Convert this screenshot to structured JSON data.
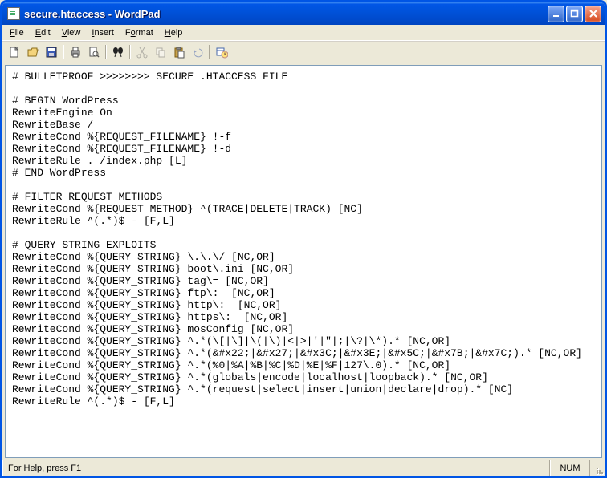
{
  "window": {
    "title": "secure.htaccess - WordPad"
  },
  "menu": {
    "file": "File",
    "edit": "Edit",
    "view": "View",
    "insert": "Insert",
    "format": "Format",
    "help": "Help"
  },
  "toolbar_icons": {
    "new": "new-file-icon",
    "open": "open-icon",
    "save": "save-icon",
    "print": "print-icon",
    "preview": "print-preview-icon",
    "find": "find-icon",
    "cut": "cut-icon",
    "copy": "copy-icon",
    "paste": "paste-icon",
    "undo": "undo-icon",
    "datetime": "datetime-icon"
  },
  "document_lines": [
    "# BULLETPROOF >>>>>>>> SECURE .HTACCESS FILE",
    "",
    "# BEGIN WordPress",
    "RewriteEngine On",
    "RewriteBase /",
    "RewriteCond %{REQUEST_FILENAME} !-f",
    "RewriteCond %{REQUEST_FILENAME} !-d",
    "RewriteRule . /index.php [L]",
    "# END WordPress",
    "",
    "# FILTER REQUEST METHODS",
    "RewriteCond %{REQUEST_METHOD} ^(TRACE|DELETE|TRACK) [NC]",
    "RewriteRule ^(.*)$ - [F,L]",
    "",
    "# QUERY STRING EXPLOITS",
    "RewriteCond %{QUERY_STRING} \\.\\.\\/ [NC,OR]",
    "RewriteCond %{QUERY_STRING} boot\\.ini [NC,OR]",
    "RewriteCond %{QUERY_STRING} tag\\= [NC,OR]",
    "RewriteCond %{QUERY_STRING} ftp\\:  [NC,OR]",
    "RewriteCond %{QUERY_STRING} http\\:  [NC,OR]",
    "RewriteCond %{QUERY_STRING} https\\:  [NC,OR]",
    "RewriteCond %{QUERY_STRING} mosConfig [NC,OR]",
    "RewriteCond %{QUERY_STRING} ^.*(\\[|\\]|\\(|\\)|<|>|'|\"|;|\\?|\\*).* [NC,OR]",
    "RewriteCond %{QUERY_STRING} ^.*(&#x22;|&#x27;|&#x3C;|&#x3E;|&#x5C;|&#x7B;|&#x7C;).* [NC,OR]",
    "RewriteCond %{QUERY_STRING} ^.*(%0|%A|%B|%C|%D|%E|%F|127\\.0).* [NC,OR]",
    "RewriteCond %{QUERY_STRING} ^.*(globals|encode|localhost|loopback).* [NC,OR]",
    "RewriteCond %{QUERY_STRING} ^.*(request|select|insert|union|declare|drop).* [NC]",
    "RewriteRule ^(.*)$ - [F,L]"
  ],
  "status": {
    "help": "For Help, press F1",
    "num": "NUM"
  }
}
